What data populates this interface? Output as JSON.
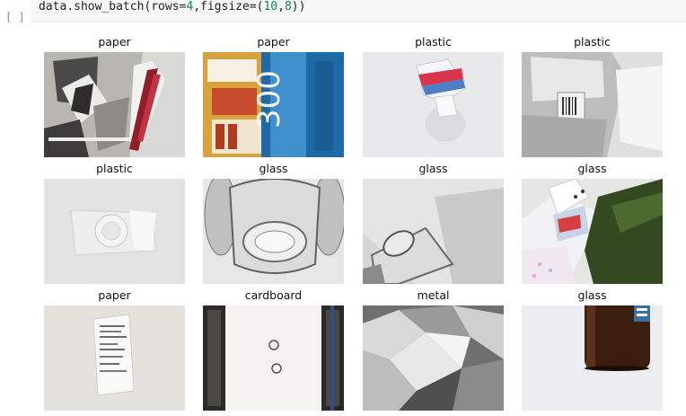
{
  "cell": {
    "prompt": "[ ]",
    "code_prefix": "data.show_batch(rows=",
    "rows_value": "4",
    "code_mid": ",figsize=(",
    "fig_w": "10",
    "comma": ",",
    "fig_h": "8",
    "code_suffix": "))"
  },
  "batch": [
    {
      "label": "paper",
      "icon": "paper-photo"
    },
    {
      "label": "paper",
      "icon": "paper-box-photo"
    },
    {
      "label": "plastic",
      "icon": "plastic-bottle-photo"
    },
    {
      "label": "plastic",
      "icon": "plastic-container-photo"
    },
    {
      "label": "plastic",
      "icon": "plastic-lid-photo"
    },
    {
      "label": "glass",
      "icon": "glass-cup-photo"
    },
    {
      "label": "glass",
      "icon": "glass-jar-photo"
    },
    {
      "label": "glass",
      "icon": "glass-bottle-photo"
    },
    {
      "label": "paper",
      "icon": "receipt-photo"
    },
    {
      "label": "cardboard",
      "icon": "cardboard-photo"
    },
    {
      "label": "metal",
      "icon": "foil-photo"
    },
    {
      "label": "glass",
      "icon": "brown-bottle-photo"
    }
  ]
}
